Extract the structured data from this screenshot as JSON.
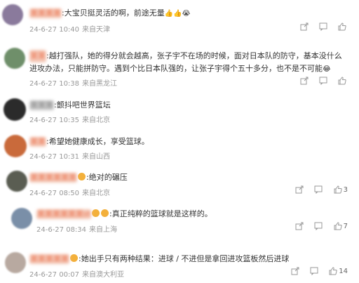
{
  "comments": [
    {
      "text": ":大宝贝挺灵活的啊，前途无量",
      "emoji": "👍👍😭",
      "time": "24-6-27 10:40",
      "source": "来自天津",
      "likes": ""
    },
    {
      "text": ":越打强队，她的得分就会越高，张子宇不在场的时候，面对日本队的防守，基本没什么进攻办法，只能拼防守。遇到个比日本队强的，让张子宇得个五十多分，也不是不可能",
      "emoji": "😂",
      "time": "24-6-27 10:38",
      "source": "来自黑龙江",
      "likes": ""
    },
    {
      "text": ":颤抖吧世界篮坛",
      "time": "24-6-27 10:35",
      "source": "来自北京",
      "likes": ""
    },
    {
      "text": ":希望她健康成长，享受篮球。",
      "time": "24-6-27 10:31",
      "source": "来自山西",
      "likes": ""
    },
    {
      "text": ":绝对的碾压",
      "time": "24-6-27 08:50",
      "source": "来自北京",
      "likes": "3"
    },
    {
      "text": ":真正纯粹的篮球就是这样的。",
      "time": "24-6-27 08:34",
      "source": "来自上海",
      "likes": "7"
    },
    {
      "text": ":她出手只有两种结果：进球 / 不进但是拿回进攻篮板然后进球",
      "time": "24-6-27 00:07",
      "source": "来自澳大利亚",
      "likes": "14"
    }
  ],
  "icons": {
    "share": "share-icon",
    "comment": "comment-icon",
    "like": "like-icon"
  }
}
